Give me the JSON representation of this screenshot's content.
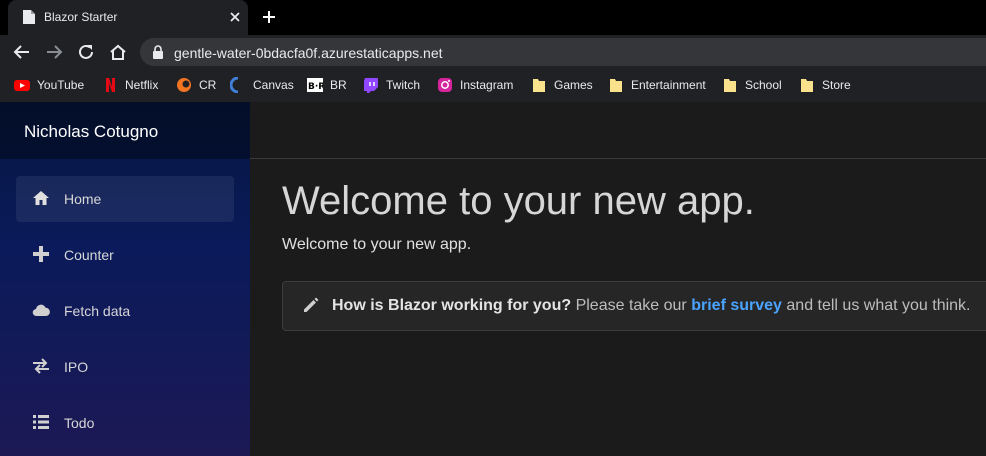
{
  "browser": {
    "tab_title": "Blazor Starter",
    "url": "gentle-water-0bdacfa0f.azurestaticapps.net",
    "bookmarks": [
      {
        "label": "YouTube",
        "icon": "youtube-icon"
      },
      {
        "label": "Netflix",
        "icon": "netflix-icon"
      },
      {
        "label": "CR",
        "icon": "crunchyroll-icon"
      },
      {
        "label": "Canvas",
        "icon": "canvas-icon"
      },
      {
        "label": "BR",
        "icon": "br-icon"
      },
      {
        "label": "Twitch",
        "icon": "twitch-icon"
      },
      {
        "label": "Instagram",
        "icon": "instagram-icon"
      },
      {
        "label": "Games",
        "icon": "folder-icon"
      },
      {
        "label": "Entertainment",
        "icon": "folder-icon"
      },
      {
        "label": "School",
        "icon": "folder-icon"
      },
      {
        "label": "Store",
        "icon": "folder-icon"
      }
    ]
  },
  "sidebar": {
    "brand": "Nicholas Cotugno",
    "items": [
      {
        "label": "Home",
        "icon": "home-icon",
        "active": true
      },
      {
        "label": "Counter",
        "icon": "plus-icon"
      },
      {
        "label": "Fetch data",
        "icon": "cloud-icon"
      },
      {
        "label": "IPO",
        "icon": "transfer-icon"
      },
      {
        "label": "Todo",
        "icon": "list-icon"
      }
    ]
  },
  "main": {
    "title": "Welcome to your new app.",
    "lead": "Welcome to your new app.",
    "survey": {
      "question": "How is Blazor working for you?",
      "before_link": "Please take our",
      "link": "brief survey",
      "after_link": "and tell us what you think."
    }
  },
  "colors": {
    "sidebar_top": "#061740",
    "sidebar_bottom": "#1c1955",
    "link": "#4aa3ff",
    "background": "#1b1b1c"
  }
}
